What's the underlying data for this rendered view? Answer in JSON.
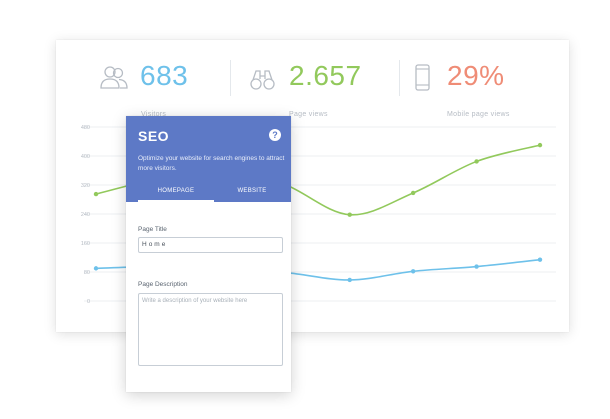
{
  "stats": {
    "visitors": {
      "value": "683",
      "label": "Visitors",
      "icon": "users-icon",
      "color": "#6ec1ea"
    },
    "page_views": {
      "value": "2.657",
      "label": "Page views",
      "icon": "binoculars-icon",
      "color": "#92c95c"
    },
    "mobile": {
      "value": "29%",
      "label": "Mobile page views",
      "icon": "smartphone-icon",
      "color": "#ef8c76"
    }
  },
  "chart_data": {
    "type": "line",
    "y_ticks": [
      "480",
      "400",
      "320",
      "240",
      "160",
      "80",
      "0"
    ],
    "ylim": [
      0,
      480
    ],
    "grid": true,
    "x": [
      0,
      1,
      2,
      3,
      4,
      5,
      6,
      7
    ],
    "series": [
      {
        "color": "#92c95c",
        "values": [
          295,
          340,
          380,
          320,
          238,
          298,
          385,
          430
        ]
      },
      {
        "color": "#6ec1ea",
        "values": [
          90,
          95,
          88,
          78,
          58,
          82,
          95,
          114
        ]
      }
    ]
  },
  "seo": {
    "title": "SEO",
    "help": "?",
    "description": "Optimize your website for search engines to attract more visitors.",
    "tabs": [
      {
        "label": "HOMEPAGE",
        "active": true
      },
      {
        "label": "WEBSITE",
        "active": false
      }
    ],
    "page_title_label": "Page Title",
    "page_title_value": "Home",
    "page_desc_label": "Page Description",
    "page_desc_placeholder": "Write a description of your website here"
  }
}
